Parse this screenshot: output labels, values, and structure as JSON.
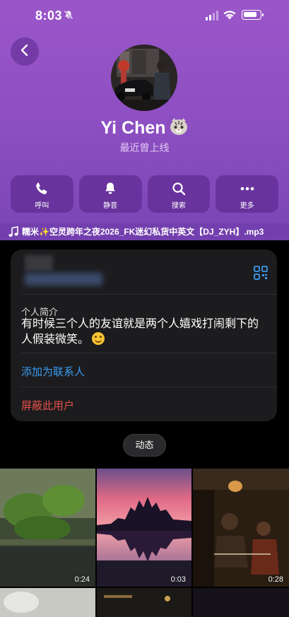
{
  "status_bar": {
    "time": "8:03"
  },
  "profile": {
    "name": "Yi Chen",
    "last_seen": "最近曾上线"
  },
  "actions": [
    {
      "label": "呼叫",
      "icon": "phone-icon"
    },
    {
      "label": "静音",
      "icon": "bell-icon"
    },
    {
      "label": "搜索",
      "icon": "search-icon"
    },
    {
      "label": "更多",
      "icon": "more-icon"
    }
  ],
  "music": {
    "text": "糯米✨空灵跨年之夜2026_FK迷幻私货中英文【DJ_ZYH】.mp3"
  },
  "info_card": {
    "bio_label": "个人简介",
    "bio_text": "有时候三个人的友谊就是两个人嬉戏打闹剩下的人假装微笑。",
    "add_contact": "添加为联系人",
    "block_user": "屏蔽此用户"
  },
  "tabs": {
    "active": "动态"
  },
  "media": [
    {
      "duration": "0:24",
      "subject": "green plants"
    },
    {
      "duration": "0:03",
      "subject": "temple sunset reflection"
    },
    {
      "duration": "0:28",
      "subject": "movie scene"
    },
    {
      "duration": "",
      "subject": "blurred"
    },
    {
      "duration": "",
      "subject": "night scene"
    },
    {
      "duration": "",
      "subject": "dark"
    }
  ],
  "colors": {
    "header_purple": "#9a56c9",
    "link_blue": "#3b9cf0",
    "danger_red": "#e8504a",
    "card_bg": "#1c1c1e"
  }
}
